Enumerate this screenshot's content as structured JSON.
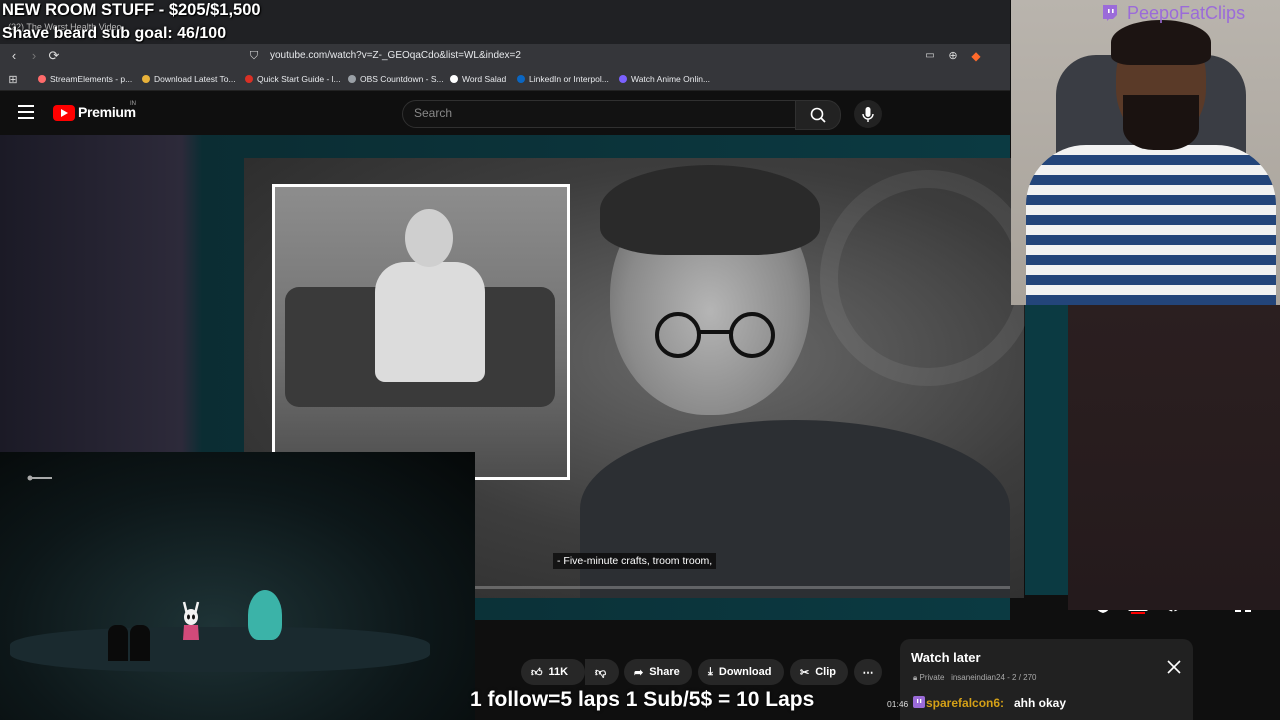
{
  "overlay": {
    "goal_line_1": "NEW ROOM STUFF - $205/$1,500",
    "goal_line_2": "Shave beard sub goal: 46/100",
    "laps_banner": "1 follow=5 laps 1 Sub/5$ = 10 Laps",
    "brand": "PeepoFatClips"
  },
  "browser": {
    "tab_title": "(22) The Worst Health Video",
    "url": "youtube.com/watch?v=Z-_GEOqaCdo&list=WL&index=2",
    "bookmarks": [
      {
        "label": "StreamElements - p...",
        "color": "#ff6b6b"
      },
      {
        "label": "Download Latest To...",
        "color": "#e8b23a"
      },
      {
        "label": "Quick Start Guide - l...",
        "color": "#d93025"
      },
      {
        "label": "OBS Countdown - S...",
        "color": "#9aa0a6"
      },
      {
        "label": "Word Salad",
        "color": "#ffffff"
      },
      {
        "label": "LinkedIn or Interpol...",
        "color": "#0a66c2"
      },
      {
        "label": "Watch Anime Onlin...",
        "color": "#7b61ff"
      }
    ]
  },
  "youtube": {
    "premium_label": "Premium",
    "region": "IN",
    "search_placeholder": "Search",
    "subtitle": "- Five-minute crafts, troom troom,",
    "actions": {
      "likes": "11K",
      "share": "Share",
      "download": "Download",
      "clip": "Clip"
    },
    "watch_later": {
      "title": "Watch later",
      "privacy": "Private",
      "owner": "insaneindian24",
      "position": "2 / 270"
    }
  },
  "chat": {
    "time": "01:46",
    "user": "sparefalcon6:",
    "message": "ahh okay"
  },
  "colors": {
    "youtube_red": "#ff0000",
    "twitch_purple": "#9b6bd9",
    "chat_user": "#d4a017"
  }
}
